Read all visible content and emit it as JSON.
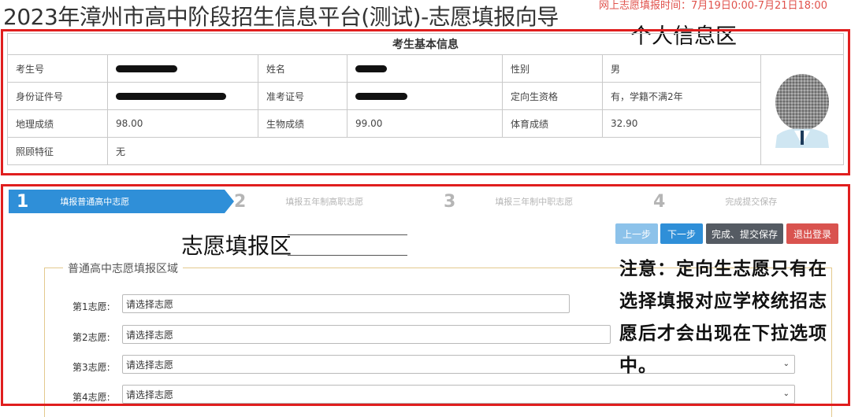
{
  "page": {
    "title": "2023年漳州市高中阶段招生信息平台(测试)-志愿填报向导",
    "deadline": "网上志愿填报时间：7月19日0:00-7月21日18:00"
  },
  "annotations": {
    "personal_area": "个人信息区",
    "wish_area": "志愿填报区",
    "note": "注意：定向生志愿只有在选择填报对应学校统招志愿后才会出现在下拉选项中。"
  },
  "info": {
    "section_title": "考生基本信息",
    "labels": {
      "student_no": "考生号",
      "name": "姓名",
      "gender": "性别",
      "id_card": "身份证件号",
      "ticket_no": "准考证号",
      "directed_qualification": "定向生资格",
      "geo_score": "地理成绩",
      "bio_score": "生物成绩",
      "pe_score": "体育成绩",
      "care_feature": "照顾特征"
    },
    "values": {
      "gender": "男",
      "directed_qualification": "有，学籍不满2年",
      "geo_score": "98.00",
      "bio_score": "99.00",
      "pe_score": "32.90",
      "care_feature": "无"
    }
  },
  "steps": [
    {
      "num": "1",
      "label": "填报普通高中志愿",
      "active": true
    },
    {
      "num": "2",
      "label": "填报五年制高职志愿",
      "active": false
    },
    {
      "num": "3",
      "label": "填报三年制中职志愿",
      "active": false
    },
    {
      "num": "4",
      "label": "完成提交保存",
      "active": false
    }
  ],
  "buttons": {
    "prev": "上一步",
    "next": "下一步",
    "submit": "完成、提交保存",
    "logout": "退出登录"
  },
  "form": {
    "legend": "普通高中志愿填报区域",
    "choices": [
      {
        "label": "第1志愿:",
        "placeholder": "请选择志愿"
      },
      {
        "label": "第2志愿:",
        "placeholder": "请选择志愿"
      },
      {
        "label": "第3志愿:",
        "placeholder": "请选择志愿"
      },
      {
        "label": "第4志愿:",
        "placeholder": "请选择志愿"
      }
    ]
  }
}
